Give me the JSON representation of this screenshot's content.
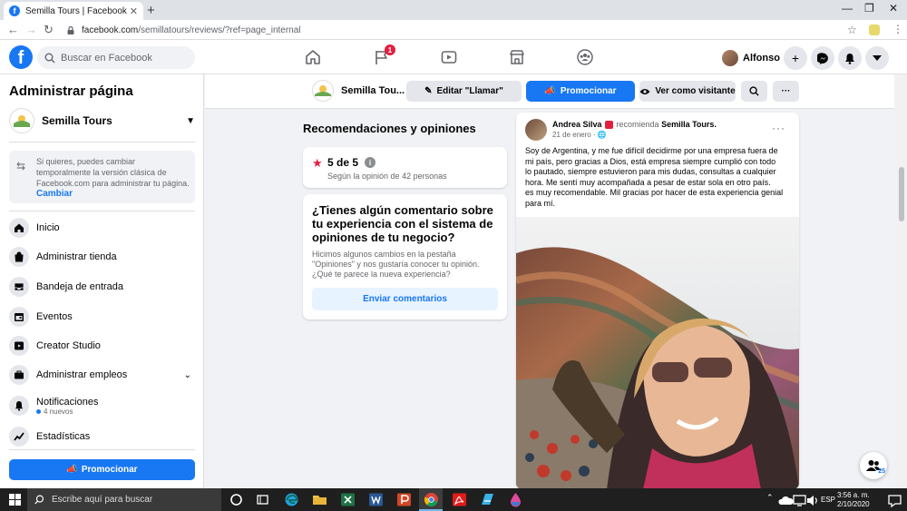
{
  "browser": {
    "tab_title": "Semilla Tours | Facebook",
    "tab_favicon": "f",
    "url_host": "facebook.com",
    "url_path": "/semillatours/reviews/?ref=page_internal"
  },
  "fb_header": {
    "logo": "f",
    "search_placeholder": "Buscar en Facebook",
    "notification_count": "1",
    "user_name": "Alfonso",
    "brand_color": "#1877f2"
  },
  "sidebar": {
    "title": "Administrar página",
    "page_name": "Semilla Tours",
    "notice_text": "Si quieres, puedes cambiar temporalmente la versión clásica de Facebook.com para administrar tu página.",
    "notice_link": "Cambiar",
    "items": [
      {
        "label": "Inicio",
        "icon": "home-icon"
      },
      {
        "label": "Administrar tienda",
        "icon": "shop-icon"
      },
      {
        "label": "Bandeja de entrada",
        "icon": "inbox-icon"
      },
      {
        "label": "Eventos",
        "icon": "calendar-icon"
      },
      {
        "label": "Creator Studio",
        "icon": "creator-studio-icon"
      },
      {
        "label": "Administrar empleos",
        "icon": "briefcase-icon"
      },
      {
        "label": "Notificaciones",
        "icon": "bell-icon",
        "sub": "4 nuevos"
      },
      {
        "label": "Estadísticas",
        "icon": "stats-icon"
      }
    ],
    "promote_label": "Promocionar"
  },
  "pagebar": {
    "page_name": "Semilla Tou...",
    "edit_label": "Editar \"Llamar\"",
    "promote_label": "Promocionar",
    "view_as_label": "Ver como visitante",
    "more_label": "···"
  },
  "reviews": {
    "title": "Recomendaciones y opiniones",
    "rating_value": "5 de 5",
    "rating_subtitle": "Según la opinión de 42 personas",
    "feedback_title": "¿Tienes algún comentario sobre tu experiencia con el sistema de opiniones de tu negocio?",
    "feedback_body": "Hicimos algunos cambios en la pestaña \"Opiniones\" y nos gustaría conocer tu opinión. ¿Qué te parece la nueva experiencia?",
    "feedback_button": "Enviar comentarios"
  },
  "post": {
    "author": "Andrea Silva",
    "action": "recomienda",
    "target": "Semilla Tours.",
    "date": "21 de enero · ",
    "more": "···",
    "body": "Soy de Argentina,  y me fue difícil decidirme por una empresa fuera de\nmi país, pero gracias a Dios, está empresa siempre cumplió con todo\nlo pautado,  siempre estuvieron para mis dudas, consultas a cualquier\nhora.  Me sentí  muy acompañada a pesar de estar sola en otro país.\nes muy recomendable. Mil gracias por hacer de esta experiencia genial\npara mí."
  },
  "floating": {
    "count": "25"
  },
  "taskbar": {
    "search_placeholder": "Escribe aquí para buscar",
    "lang": "ESP",
    "time": "3:56 a. m.",
    "date": "2/10/2020"
  }
}
